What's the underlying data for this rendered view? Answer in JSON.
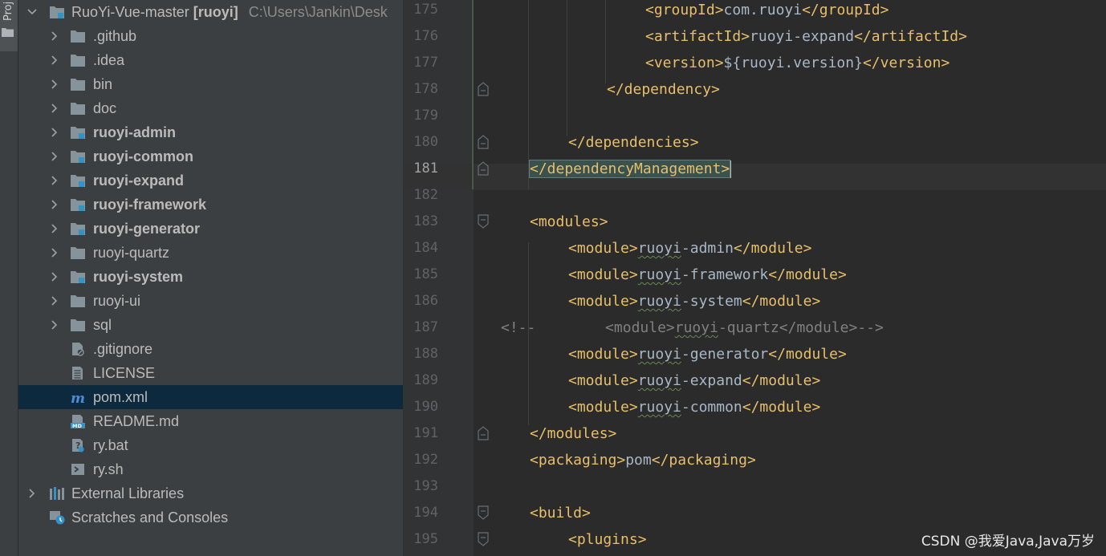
{
  "tool_window": {
    "label": "Proj"
  },
  "project_tree": {
    "root": {
      "name": "RuoYi-Vue-master",
      "module": "[ruoyi]",
      "path": "C:\\Users\\Jankin\\Desk"
    },
    "items": [
      {
        "label": ".github",
        "type": "folder",
        "bold": false,
        "expandable": true
      },
      {
        "label": ".idea",
        "type": "folder",
        "bold": false,
        "expandable": true
      },
      {
        "label": "bin",
        "type": "folder",
        "bold": false,
        "expandable": true
      },
      {
        "label": "doc",
        "type": "folder",
        "bold": false,
        "expandable": true
      },
      {
        "label": "ruoyi-admin",
        "type": "module-folder",
        "bold": true,
        "expandable": true
      },
      {
        "label": "ruoyi-common",
        "type": "module-folder",
        "bold": true,
        "expandable": true
      },
      {
        "label": "ruoyi-expand",
        "type": "module-folder",
        "bold": true,
        "expandable": true
      },
      {
        "label": "ruoyi-framework",
        "type": "module-folder",
        "bold": true,
        "expandable": true
      },
      {
        "label": "ruoyi-generator",
        "type": "module-folder",
        "bold": true,
        "expandable": true
      },
      {
        "label": "ruoyi-quartz",
        "type": "folder",
        "bold": false,
        "expandable": true
      },
      {
        "label": "ruoyi-system",
        "type": "module-folder",
        "bold": true,
        "expandable": true
      },
      {
        "label": "ruoyi-ui",
        "type": "folder",
        "bold": false,
        "expandable": true
      },
      {
        "label": "sql",
        "type": "folder",
        "bold": false,
        "expandable": true
      },
      {
        "label": ".gitignore",
        "type": "gitignore-file",
        "bold": false,
        "expandable": false
      },
      {
        "label": "LICENSE",
        "type": "text-file",
        "bold": false,
        "expandable": false
      },
      {
        "label": "pom.xml",
        "type": "maven-file",
        "bold": false,
        "expandable": false,
        "selected": true
      },
      {
        "label": "README.md",
        "type": "markdown-file",
        "bold": false,
        "expandable": false
      },
      {
        "label": "ry.bat",
        "type": "bat-file",
        "bold": false,
        "expandable": false
      },
      {
        "label": "ry.sh",
        "type": "shell-file",
        "bold": false,
        "expandable": false
      }
    ],
    "external_libraries": "External Libraries",
    "scratches": "Scratches and Consoles"
  },
  "editor": {
    "current_line": 181,
    "lines": [
      {
        "no": "175",
        "segments": [
          {
            "t": "<groupId>",
            "c": "tag"
          },
          {
            "t": "com.ruoyi",
            "c": "txt"
          },
          {
            "t": "</groupId>",
            "c": "tag"
          }
        ]
      },
      {
        "no": "176",
        "segments": [
          {
            "t": "<artifactId>",
            "c": "tag"
          },
          {
            "t": "ruoyi-expand",
            "c": "txt"
          },
          {
            "t": "</artifactId>",
            "c": "tag"
          }
        ]
      },
      {
        "no": "177",
        "segments": [
          {
            "t": "<version>",
            "c": "tag"
          },
          {
            "t": "${ruoyi.version}",
            "c": "txt"
          },
          {
            "t": "</version>",
            "c": "tag"
          }
        ]
      },
      {
        "no": "178",
        "segments": [
          {
            "t": "</dependency>",
            "c": "tag"
          }
        ]
      },
      {
        "no": "179",
        "segments": []
      },
      {
        "no": "180",
        "segments": [
          {
            "t": "</dependencies>",
            "c": "tag"
          }
        ]
      },
      {
        "no": "181",
        "segments": [
          {
            "t": "</dependencyManagement>",
            "c": "tag"
          }
        ]
      },
      {
        "no": "182",
        "segments": []
      },
      {
        "no": "183",
        "segments": [
          {
            "t": "<modules>",
            "c": "tag"
          }
        ]
      },
      {
        "no": "184",
        "segments": [
          {
            "t": "<module>",
            "c": "tag"
          },
          {
            "t": "ruoyi",
            "c": "typo"
          },
          {
            "t": "-admin",
            "c": "txt"
          },
          {
            "t": "</module>",
            "c": "tag"
          }
        ]
      },
      {
        "no": "185",
        "segments": [
          {
            "t": "<module>",
            "c": "tag"
          },
          {
            "t": "ruoyi",
            "c": "typo"
          },
          {
            "t": "-framework",
            "c": "txt"
          },
          {
            "t": "</module>",
            "c": "tag"
          }
        ]
      },
      {
        "no": "186",
        "segments": [
          {
            "t": "<module>",
            "c": "tag"
          },
          {
            "t": "ruoyi",
            "c": "typo"
          },
          {
            "t": "-system",
            "c": "txt"
          },
          {
            "t": "</module>",
            "c": "tag"
          }
        ]
      },
      {
        "no": "187",
        "segments": [
          {
            "t": "<!--",
            "c": "cmt"
          },
          {
            "t": "        <module>",
            "c": "cmt"
          },
          {
            "t": "ruoyi",
            "c": "cmt typo"
          },
          {
            "t": "-quartz</module>-->",
            "c": "cmt"
          }
        ]
      },
      {
        "no": "188",
        "segments": [
          {
            "t": "<module>",
            "c": "tag"
          },
          {
            "t": "ruoyi",
            "c": "typo"
          },
          {
            "t": "-generator",
            "c": "txt"
          },
          {
            "t": "</module>",
            "c": "tag"
          }
        ]
      },
      {
        "no": "189",
        "segments": [
          {
            "t": "<module>",
            "c": "tag"
          },
          {
            "t": "ruoyi",
            "c": "typo"
          },
          {
            "t": "-expand",
            "c": "txt"
          },
          {
            "t": "</module>",
            "c": "tag"
          }
        ]
      },
      {
        "no": "190",
        "segments": [
          {
            "t": "<module>",
            "c": "tag"
          },
          {
            "t": "ruoyi",
            "c": "typo"
          },
          {
            "t": "-common",
            "c": "txt"
          },
          {
            "t": "</module>",
            "c": "tag"
          }
        ]
      },
      {
        "no": "191",
        "segments": [
          {
            "t": "</modules>",
            "c": "tag"
          }
        ]
      },
      {
        "no": "192",
        "segments": [
          {
            "t": "<packaging>",
            "c": "tag"
          },
          {
            "t": "pom",
            "c": "txt"
          },
          {
            "t": "</packaging>",
            "c": "tag"
          }
        ]
      },
      {
        "no": "193",
        "segments": []
      },
      {
        "no": "194",
        "segments": [
          {
            "t": "<build>",
            "c": "tag"
          }
        ]
      },
      {
        "no": "195",
        "segments": [
          {
            "t": "<plugins>",
            "c": "tag"
          }
        ]
      }
    ]
  },
  "watermark": "CSDN @我爱Java,Java万岁",
  "colors": {
    "tag": "#e8bf6a",
    "text": "#a9b7c6",
    "comment": "#808080",
    "selection": "#0d293e",
    "panel": "#3c3f41",
    "editor": "#2b2b2b"
  }
}
